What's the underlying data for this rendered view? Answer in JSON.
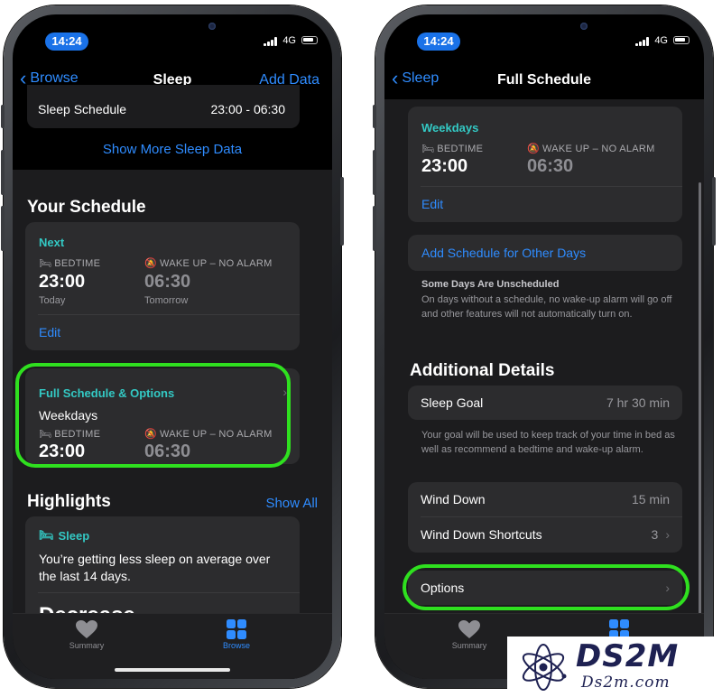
{
  "status_bar": {
    "time": "14:24",
    "network": "4G"
  },
  "left": {
    "nav": {
      "back_label": "Browse",
      "title": "Sleep",
      "right_label": "Add Data"
    },
    "sleep_schedule_row": {
      "label": "Sleep Schedule",
      "value": "23:00 - 06:30"
    },
    "show_more_label": "Show More Sleep Data",
    "your_schedule_title": "Your Schedule",
    "next_card": {
      "header": "Next",
      "bedtime_label": "BEDTIME",
      "bedtime_time": "23:00",
      "bedtime_day": "Today",
      "wakeup_label": "WAKE UP – NO ALARM",
      "wakeup_time": "06:30",
      "wakeup_day": "Tomorrow",
      "edit_label": "Edit"
    },
    "full_schedule_card": {
      "header": "Full Schedule & Options",
      "subtitle": "Weekdays",
      "bedtime_label": "BEDTIME",
      "bedtime_time": "23:00",
      "wakeup_label": "WAKE UP – NO ALARM",
      "wakeup_time": "06:30"
    },
    "highlights": {
      "title": "Highlights",
      "show_all_label": "Show All",
      "card_header": "Sleep",
      "card_text": "You’re getting less sleep on average over the last 14 days.",
      "partial_text": "Decrease"
    },
    "tabbar": {
      "summary_label": "Summary",
      "browse_label": "Browse"
    }
  },
  "right": {
    "nav": {
      "back_label": "Sleep",
      "title": "Full Schedule"
    },
    "weekdays_card": {
      "header": "Weekdays",
      "bedtime_label": "BEDTIME",
      "bedtime_time": "23:00",
      "wakeup_label": "WAKE UP – NO ALARM",
      "wakeup_time": "06:30",
      "edit_label": "Edit"
    },
    "add_schedule_label": "Add Schedule for Other Days",
    "unscheduled_title": "Some Days Are Unscheduled",
    "unscheduled_text": "On days without a schedule, no wake-up alarm will go off and other features will not automatically turn on.",
    "additional_details_title": "Additional Details",
    "sleep_goal": {
      "label": "Sleep Goal",
      "value": "7 hr 30 min"
    },
    "sleep_goal_note": "Your goal will be used to keep track of your time in bed as well as recommend a bedtime and wake-up alarm.",
    "wind_down": {
      "label": "Wind Down",
      "value": "15 min"
    },
    "wind_down_shortcuts": {
      "label": "Wind Down Shortcuts",
      "value": "3"
    },
    "options_label": "Options",
    "tabbar": {
      "summary_label": "Summary"
    }
  },
  "watermark": {
    "name": "DS2M",
    "url": "Ds2m.com"
  },
  "colors": {
    "accent": "#2f8cff",
    "teal": "#33c9c4",
    "highlight_ring": "#2fe01f",
    "time_pill": "#1a72e8"
  },
  "icons": [
    "bed-icon",
    "bell-slash-icon",
    "heart-icon",
    "grid-icon",
    "chevron-left-icon",
    "chevron-right-icon"
  ]
}
